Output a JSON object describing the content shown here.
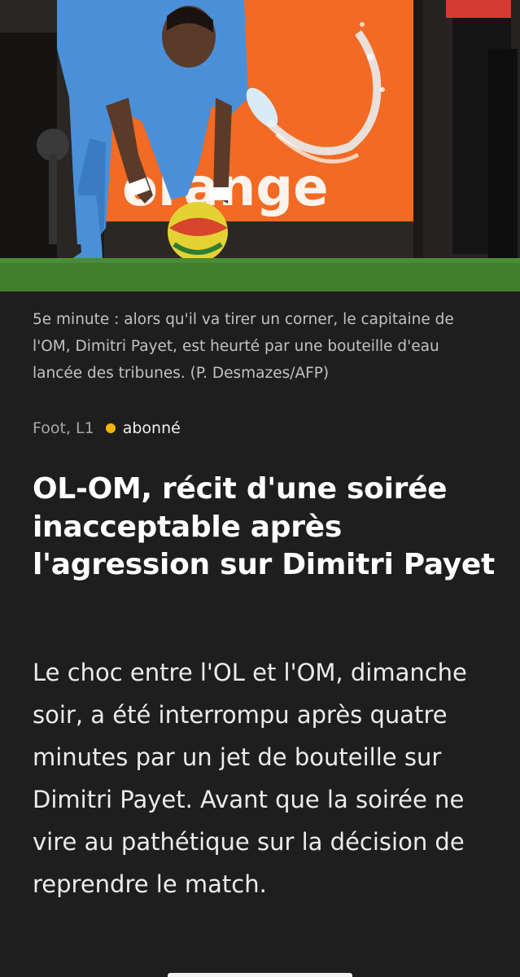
{
  "article": {
    "photo": {
      "description_icon": "football-corner-photo",
      "board_text": "orange",
      "caption": "5e minute : alors qu'il va tirer un corner, le capitaine de l'OM, Dimitri Payet, est heurté par une bouteille d'eau lancée des tribunes. (P. Desmazes/AFP)"
    },
    "category": "Foot, L1",
    "subscriber_label": "abonné",
    "headline": "OL-OM, récit d'une soirée inacceptable après l'agression sur Dimitri Payet",
    "lead": "Le choc entre l'OL et l'OM, dimanche soir, a été interrompu après quatre minutes par un jet de bouteille sur Dimitri Payet. Avant que la soirée ne vire au pathétique sur la décision de reprendre le match."
  },
  "colors": {
    "background": "#1e1e1e",
    "subscriber_dot": "#f2b705",
    "board_orange": "#f26a23",
    "jersey_blue": "#4a90d9",
    "pitch_green": "#3f7f2c"
  }
}
